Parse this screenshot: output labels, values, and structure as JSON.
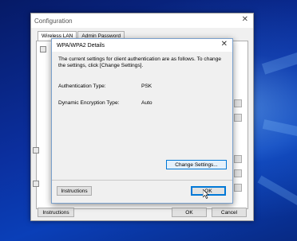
{
  "config_window": {
    "title": "Configuration",
    "close_glyph": "✕",
    "tabs": [
      {
        "label": "Wireless LAN"
      },
      {
        "label": "Admin Password"
      }
    ],
    "instructions_label": "Instructions",
    "ok_label": "OK",
    "cancel_label": "Cancel"
  },
  "dialog": {
    "title": "WPA/WPA2 Details",
    "close_glyph": "✕",
    "description": "The current settings for client authentication are as follows. To change the settings, click [Change Settings].",
    "fields": [
      {
        "label": "Authentication Type:",
        "value": "PSK"
      },
      {
        "label": "Dynamic Encryption Type:",
        "value": "Auto"
      }
    ],
    "change_settings_label": "Change Settings...",
    "instructions_label": "Instructions",
    "ok_label": "OK"
  }
}
